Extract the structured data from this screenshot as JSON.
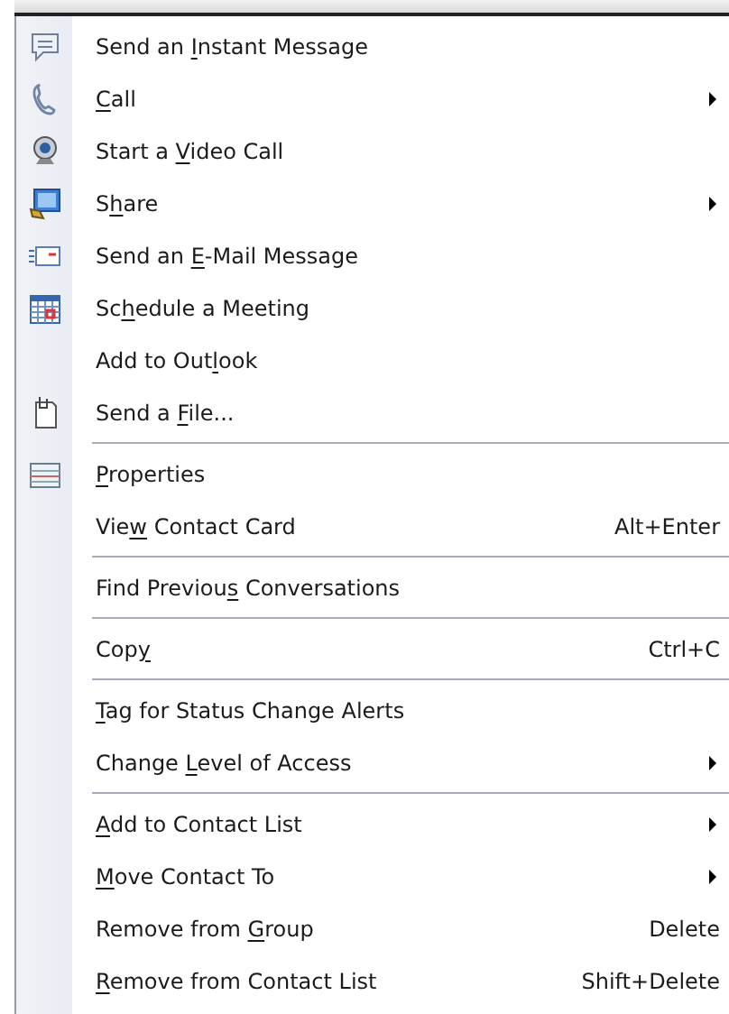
{
  "menu": {
    "entries": [
      {
        "kind": "item",
        "label": {
          "pre": "Send an ",
          "key": "I",
          "post": "nstant Message"
        },
        "submenu": false
      },
      {
        "kind": "item",
        "label": {
          "key": "C",
          "post": "all"
        },
        "submenu": true
      },
      {
        "kind": "item",
        "label": {
          "pre": "Start a ",
          "key": "V",
          "post": "ideo Call"
        },
        "submenu": false
      },
      {
        "kind": "item",
        "label": {
          "pre": "S",
          "key": "h",
          "post": "are"
        },
        "submenu": true
      },
      {
        "kind": "item",
        "label": {
          "pre": "Send an ",
          "key": "E",
          "post": "-Mail Message"
        },
        "submenu": false
      },
      {
        "kind": "item",
        "label": {
          "pre": "Sc",
          "key": "h",
          "post": "edule a Meeting"
        },
        "submenu": false
      },
      {
        "kind": "item",
        "label": {
          "pre": "Add to Out",
          "key": "l",
          "post": "ook"
        },
        "submenu": false
      },
      {
        "kind": "item",
        "label": {
          "pre": "Send a ",
          "key": "F",
          "post": "ile..."
        },
        "submenu": false
      },
      {
        "kind": "separator"
      },
      {
        "kind": "item",
        "label": {
          "key": "P",
          "post": "roperties"
        },
        "submenu": false
      },
      {
        "kind": "item",
        "label": {
          "pre": "Vie",
          "key": "w",
          "post": " Contact Card"
        },
        "shortcut": "Alt+Enter",
        "submenu": false
      },
      {
        "kind": "separator"
      },
      {
        "kind": "item",
        "label": {
          "pre": "Find Previou",
          "key": "s",
          "post": " Conversations"
        },
        "submenu": false
      },
      {
        "kind": "separator"
      },
      {
        "kind": "item",
        "label": {
          "pre": "Cop",
          "key": "y"
        },
        "shortcut": "Ctrl+C",
        "submenu": false
      },
      {
        "kind": "separator"
      },
      {
        "kind": "item",
        "label": {
          "key": "T",
          "post": "ag for Status Change Alerts"
        },
        "submenu": false
      },
      {
        "kind": "item",
        "label": {
          "pre": "Change ",
          "key": "L",
          "post": "evel of Access"
        },
        "submenu": true
      },
      {
        "kind": "separator"
      },
      {
        "kind": "item",
        "label": {
          "key": "A",
          "post": "dd to Contact List"
        },
        "submenu": true
      },
      {
        "kind": "item",
        "label": {
          "key": "M",
          "post": "ove Contact To"
        },
        "submenu": true
      },
      {
        "kind": "item",
        "label": {
          "pre": "Remove from ",
          "key": "G",
          "post": "roup"
        },
        "shortcut": "Delete",
        "submenu": false
      },
      {
        "kind": "item",
        "label": {
          "key": "R",
          "post": "emove from Contact List"
        },
        "shortcut": "Shift+Delete",
        "submenu": false
      }
    ]
  }
}
